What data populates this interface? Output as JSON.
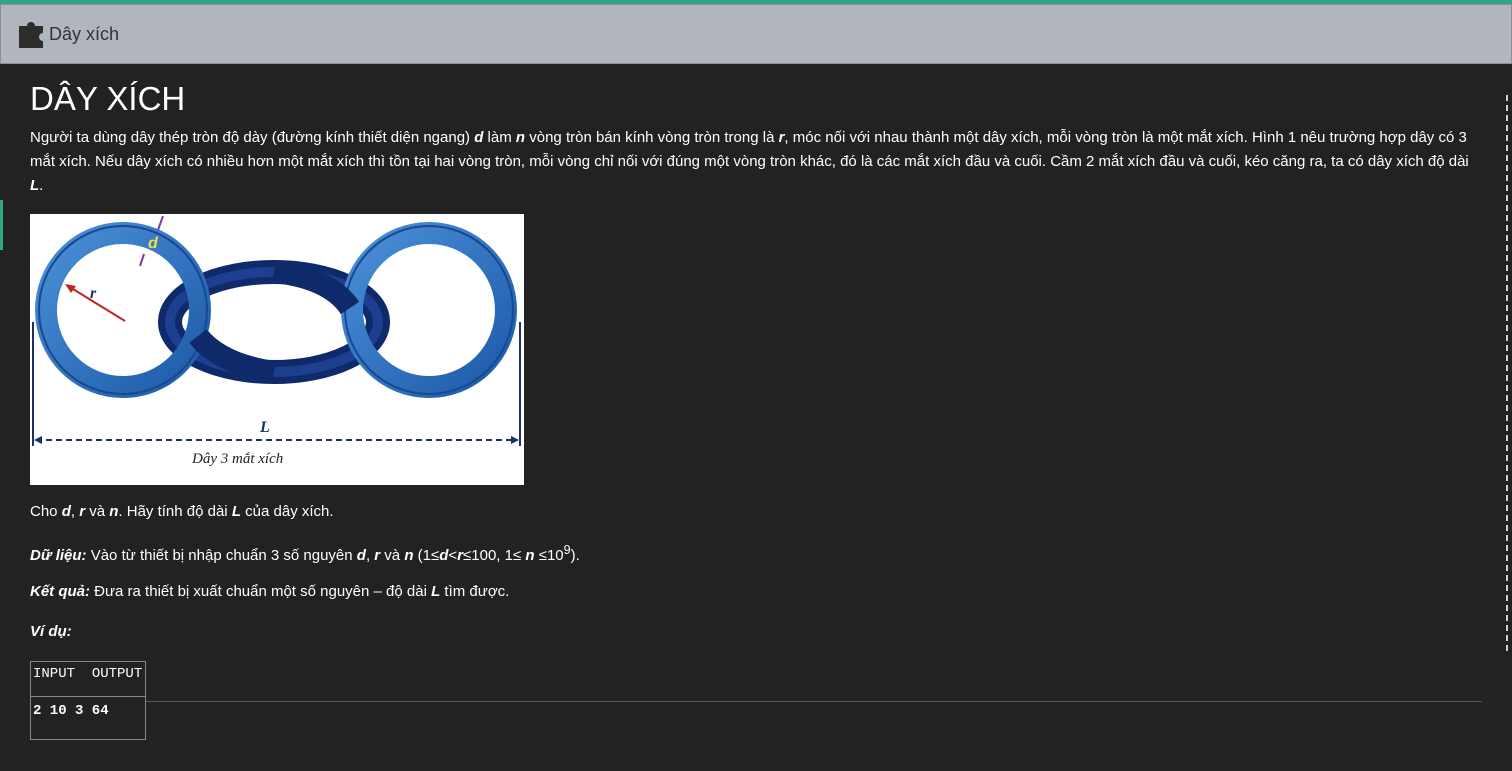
{
  "header": {
    "title": "Dây xích",
    "icon": "puzzle-piece-icon"
  },
  "problem": {
    "heading": "DÂY XÍCH",
    "intro": {
      "p1": "Người ta dùng dây thép tròn độ dày (đường kính thiết diện ngang) ",
      "d": "d",
      "p2": " làm ",
      "n": "n",
      "p3": " vòng tròn bán kính vòng tròn trong là ",
      "r": "r",
      "p4": ", móc nối với nhau thành một dây xích, mỗi vòng tròn là một mắt xích. Hình 1 nêu trường hợp dây có 3 mắt xích. Nếu dây xích có nhiều hơn một mắt xích thì tồn tại hai vòng tròn, mỗi vòng chỉ nối với đúng một vòng tròn khác, đó là các mắt xích đầu và cuối.  Cầm 2 mắt xích đầu và cuối, kéo căng ra, ta có dây xích độ dài ",
      "L": "L",
      "p5": "."
    },
    "figure": {
      "label_d": "d",
      "label_r": "r",
      "label_L": "L",
      "caption": "Dây 3 mắt xích"
    },
    "task": {
      "t1": "Cho ",
      "d": "d",
      "c1": ", ",
      "r": "r",
      "t2": " và ",
      "n": "n",
      "t3": ". Hãy tính độ dài ",
      "L": "L",
      "t4": " của dây xích."
    },
    "input_spec": {
      "label": "Dữ liệu:",
      "t1": " Vào từ thiết bị nhập chuẩn 3 số nguyên ",
      "d": "d",
      "c1": ", ",
      "r": "r",
      "t2": " và ",
      "n": "n",
      "t3": " (1≤",
      "d2": "d",
      "t4": "<",
      "r2": "r",
      "t5": "≤100, 1≤ ",
      "n2": "n",
      "t6": " ≤10",
      "exp": "9",
      "t7": ")."
    },
    "output_spec": {
      "label": "Kết quả:",
      "t1": " Đưa ra thiết bị xuất chuẩn một số nguyên – độ dài ",
      "L": "L",
      "t2": " tìm được."
    },
    "example_label": "Ví dụ:",
    "sample": {
      "headers": [
        "INPUT",
        "OUTPUT"
      ],
      "row": "2 10 3 64"
    }
  },
  "colors": {
    "accent": "#2ea583",
    "background": "#222222",
    "header_bg": "#b1b5bd"
  }
}
